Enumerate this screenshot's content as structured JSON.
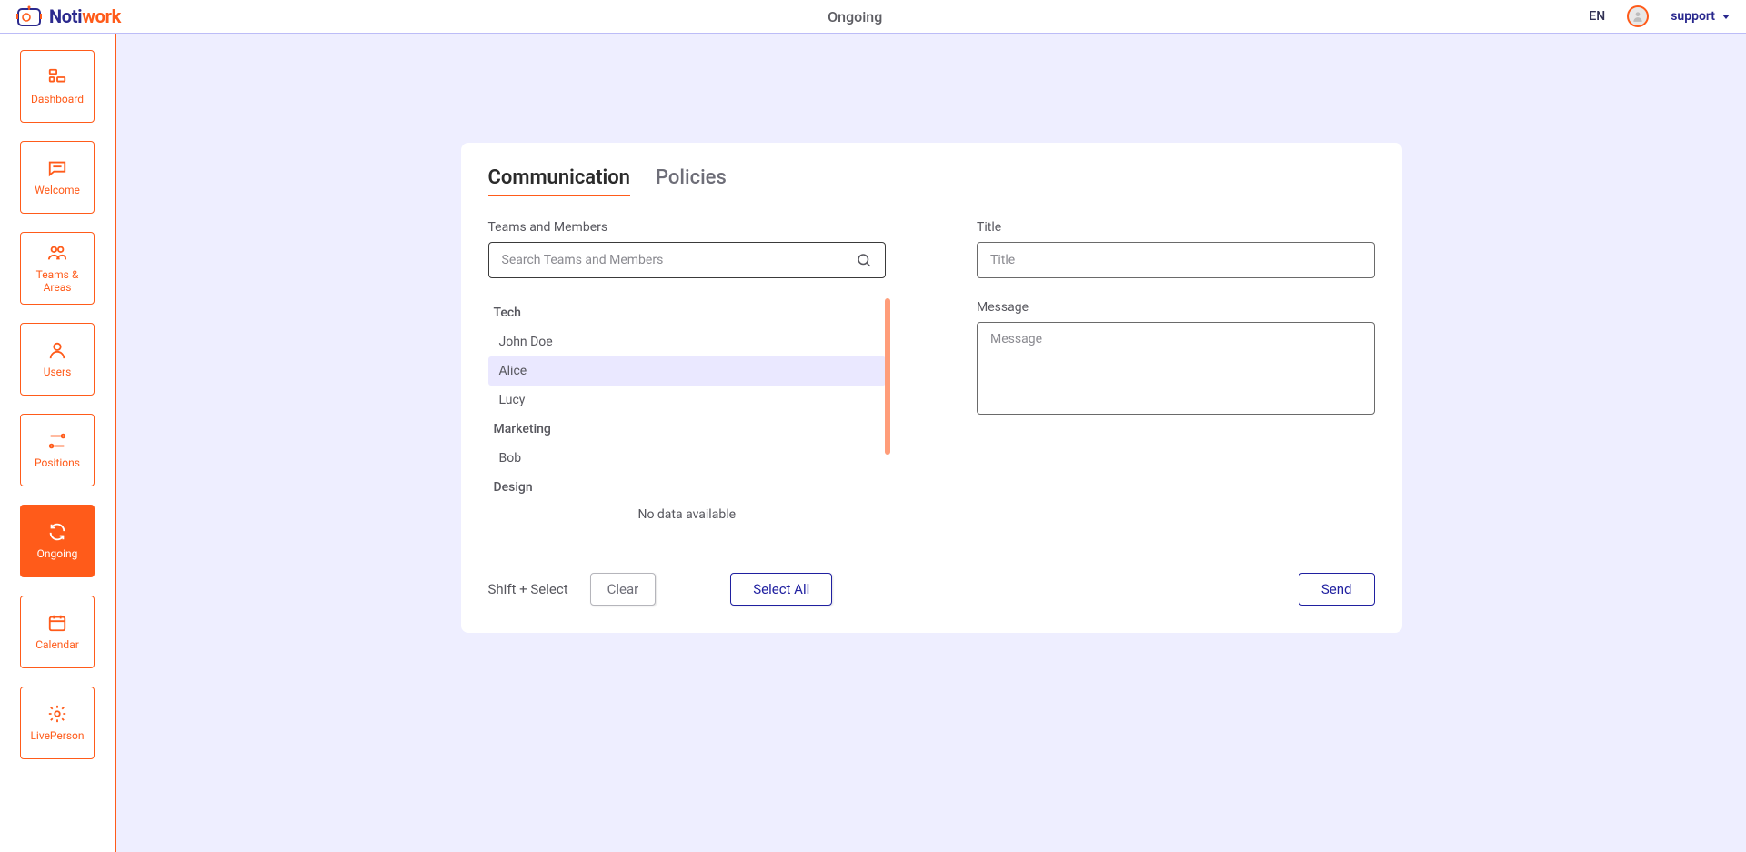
{
  "header": {
    "logo_noti": "Noti",
    "logo_work": "work",
    "title": "Ongoing",
    "lang": "EN",
    "user": "support"
  },
  "sidebar": {
    "items": [
      {
        "label": "Dashboard",
        "icon": "dashboard-icon"
      },
      {
        "label": "Welcome",
        "icon": "chat-icon"
      },
      {
        "label": "Teams & Areas",
        "icon": "teams-icon"
      },
      {
        "label": "Users",
        "icon": "user-icon"
      },
      {
        "label": "Positions",
        "icon": "positions-icon"
      },
      {
        "label": "Ongoing",
        "icon": "refresh-icon"
      },
      {
        "label": "Calendar",
        "icon": "calendar-icon"
      },
      {
        "label": "LivePerson",
        "icon": "gear-icon"
      }
    ],
    "active_index": 5
  },
  "tabs": [
    {
      "label": "Communication",
      "active": true
    },
    {
      "label": "Policies",
      "active": false
    }
  ],
  "left_panel": {
    "label": "Teams and Members",
    "search_placeholder": "Search Teams and Members",
    "groups": [
      {
        "name": "Tech",
        "members": [
          "John Doe",
          "Alice",
          "Lucy"
        ]
      },
      {
        "name": "Marketing",
        "members": [
          "Bob"
        ]
      },
      {
        "name": "Design",
        "members": []
      }
    ],
    "no_data": "No data available",
    "hover_member": "Alice",
    "hint": "Shift + Select",
    "clear": "Clear",
    "select_all": "Select All"
  },
  "right_panel": {
    "title_label": "Title",
    "title_placeholder": "Title",
    "message_label": "Message",
    "message_placeholder": "Message",
    "send": "Send"
  }
}
